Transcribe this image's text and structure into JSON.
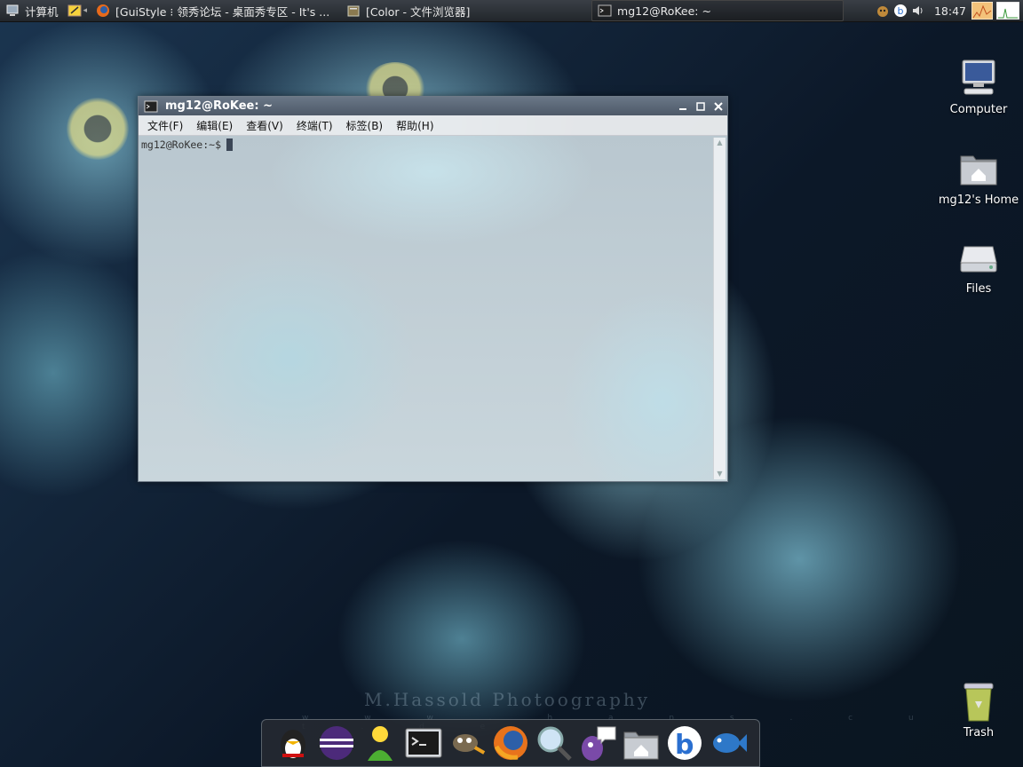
{
  "top_panel": {
    "menu_label": "计算机",
    "tasks": [
      {
        "label": "[GuiStyle ⁝ 领秀论坛 - 桌面秀专区 - It's ...",
        "icon": "firefox-icon"
      },
      {
        "label": "[Color - 文件浏览器]",
        "icon": "file-browser-icon"
      },
      {
        "label": "mg12@RoKee: ~",
        "icon": "terminal-icon"
      }
    ],
    "clock": "18:47"
  },
  "terminal": {
    "title": "mg12@RoKee: ~",
    "menus": [
      "文件(F)",
      "编辑(E)",
      "查看(V)",
      "终端(T)",
      "标签(B)",
      "帮助(H)"
    ],
    "prompt": "mg12@RoKee:~$"
  },
  "desktop_icons": {
    "computer": "Computer",
    "home": "mg12's Home",
    "files": "Files",
    "trash": "Trash"
  },
  "wallpaper": {
    "title": "M.Hassold Photoography",
    "url": "w w w . h a n s . c u l t . d e"
  },
  "colors": {
    "panel": "#2b2f35",
    "titlebar": "#5a6676",
    "accent": "#4d5968"
  }
}
